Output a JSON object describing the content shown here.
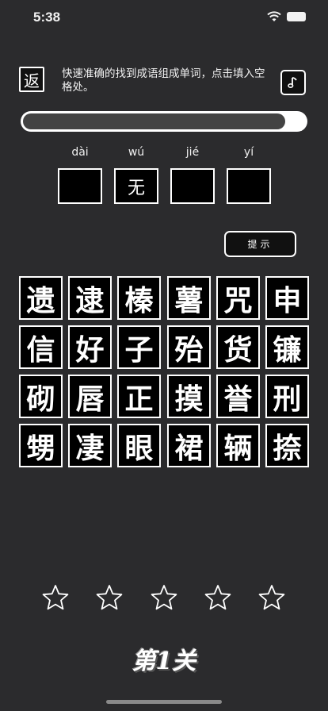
{
  "status_bar": {
    "time": "5:38"
  },
  "header": {
    "back_label": "返",
    "instructions": "快速准确的找到成语组成单词，点击填入空格处。",
    "music_icon": "music-note-icon"
  },
  "progress": {
    "fraction": 0.93
  },
  "answer": {
    "pinyin": [
      "dài",
      "wú",
      "jié",
      "yí"
    ],
    "slots": [
      "",
      "无",
      "",
      ""
    ]
  },
  "hint_label": "提示",
  "characters": [
    "遗",
    "逮",
    "榛",
    "薯",
    "咒",
    "申",
    "信",
    "好",
    "子",
    "殆",
    "货",
    "镰",
    "砌",
    "唇",
    "正",
    "摸",
    "誉",
    "刑",
    "甥",
    "凄",
    "眼",
    "裙",
    "辆",
    "捺"
  ],
  "stars": {
    "total": 5,
    "filled": 0
  },
  "level_title": "第1关",
  "colors": {
    "background": "#2b2b2d",
    "tile": "#000000",
    "border": "#ffffff"
  }
}
